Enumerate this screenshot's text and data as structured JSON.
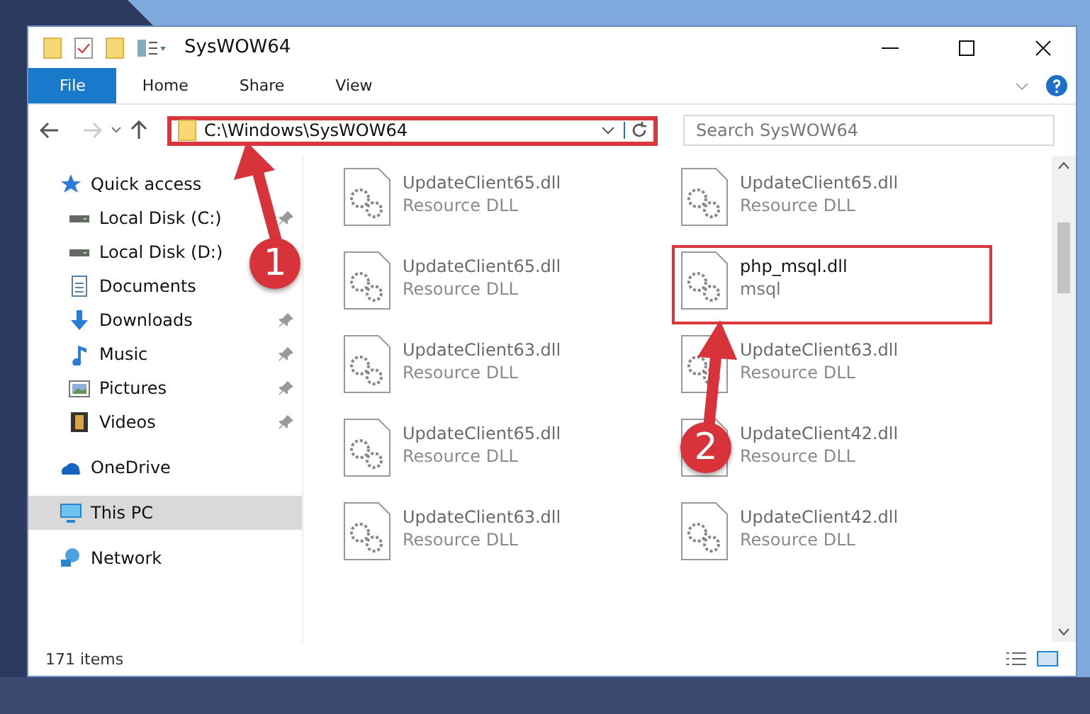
{
  "window": {
    "title": "SysWOW64"
  },
  "ribbon": {
    "tabs": [
      {
        "label": "File",
        "selected": true
      },
      {
        "label": "Home",
        "selected": false
      },
      {
        "label": "Share",
        "selected": false
      },
      {
        "label": "View",
        "selected": false
      }
    ]
  },
  "address_bar": {
    "value": "C:\\Windows\\SysWOW64",
    "highlighted": true
  },
  "search": {
    "placeholder": "Search SysWOW64"
  },
  "sidebar": {
    "items": [
      {
        "label": "Quick access",
        "kind": "star",
        "selected": false,
        "children": [
          {
            "label": "Local Disk (C:)",
            "kind": "drive",
            "pinned": true
          },
          {
            "label": "Local Disk (D:)",
            "kind": "drive",
            "pinned": false
          },
          {
            "label": "Documents",
            "kind": "document",
            "pinned": false
          },
          {
            "label": "Downloads",
            "kind": "download",
            "pinned": true
          },
          {
            "label": "Music",
            "kind": "music",
            "pinned": true
          },
          {
            "label": "Pictures",
            "kind": "pictures",
            "pinned": true
          },
          {
            "label": "Videos",
            "kind": "videos",
            "pinned": true
          }
        ]
      },
      {
        "label": "OneDrive",
        "kind": "cloud",
        "selected": false
      },
      {
        "label": "This PC",
        "kind": "pc",
        "selected": true
      },
      {
        "label": "Network",
        "kind": "network",
        "selected": false
      }
    ]
  },
  "files": [
    {
      "name": "UpdateClient65.dll",
      "type": "Resource DLL",
      "blurred": true,
      "highlighted": false
    },
    {
      "name": "UpdateClient65.dll",
      "type": "Resource DLL",
      "blurred": true,
      "highlighted": false
    },
    {
      "name": "UpdateClient65.dll",
      "type": "Resource DLL",
      "blurred": true,
      "highlighted": false
    },
    {
      "name": "php_msql.dll",
      "type": "msql",
      "blurred": false,
      "highlighted": true
    },
    {
      "name": "UpdateClient63.dll",
      "type": "Resource DLL",
      "blurred": true,
      "highlighted": false
    },
    {
      "name": "UpdateClient63.dll",
      "type": "Resource DLL",
      "blurred": true,
      "highlighted": false
    },
    {
      "name": "UpdateClient65.dll",
      "type": "Resource DLL",
      "blurred": true,
      "highlighted": false
    },
    {
      "name": "UpdateClient42.dll",
      "type": "Resource DLL",
      "blurred": true,
      "highlighted": false
    },
    {
      "name": "UpdateClient63.dll",
      "type": "Resource DLL",
      "blurred": true,
      "highlighted": false
    },
    {
      "name": "UpdateClient42.dll",
      "type": "Resource DLL",
      "blurred": true,
      "highlighted": false
    }
  ],
  "status_bar": {
    "item_count": "171 items"
  },
  "annotations": [
    {
      "label": "1"
    },
    {
      "label": "2"
    }
  ]
}
